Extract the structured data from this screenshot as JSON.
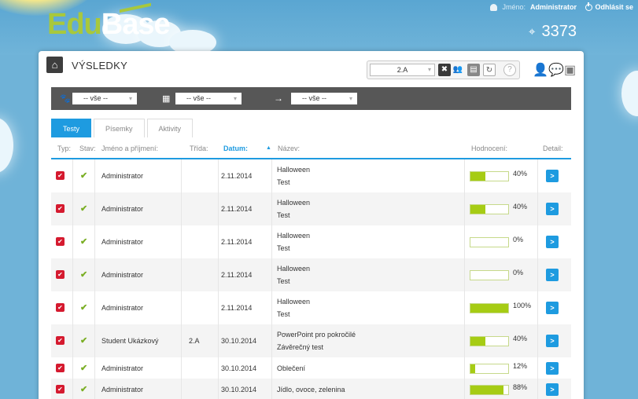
{
  "app": {
    "logo_edu": "Edu",
    "logo_base": "Base"
  },
  "topbar": {
    "user_label": "Jméno:",
    "user_name": "Administrator",
    "logout_label": "Odhlásit se",
    "points": "3373"
  },
  "page": {
    "title": "VÝSLEDKY"
  },
  "toolbar": {
    "class_value": "2.A",
    "help_label": "?"
  },
  "filters": {
    "first": "-- vše --",
    "second": "-- vše --",
    "third": "-- vše --"
  },
  "tabs": [
    {
      "label": "Testy",
      "active": true
    },
    {
      "label": "Písemky",
      "active": false
    },
    {
      "label": "Aktivity",
      "active": false
    }
  ],
  "columns": {
    "type": "Typ:",
    "state": "Stav:",
    "name": "Jméno a příjmení:",
    "class": "Třída:",
    "date": "Datum:",
    "title": "Název:",
    "score": "Hodnocení:",
    "detail": "Detail:"
  },
  "rows": [
    {
      "name": "Administrator",
      "class": "",
      "date": "2.11.2014",
      "title1": "Halloween",
      "title2": "Test",
      "score": "40%",
      "fill": 0.4
    },
    {
      "name": "Administrator",
      "class": "",
      "date": "2.11.2014",
      "title1": "Halloween",
      "title2": "Test",
      "score": "40%",
      "fill": 0.4
    },
    {
      "name": "Administrator",
      "class": "",
      "date": "2.11.2014",
      "title1": "Halloween",
      "title2": "Test",
      "score": "0%",
      "fill": 0.0
    },
    {
      "name": "Administrator",
      "class": "",
      "date": "2.11.2014",
      "title1": "Halloween",
      "title2": "Test",
      "score": "0%",
      "fill": 0.0
    },
    {
      "name": "Administrator",
      "class": "",
      "date": "2.11.2014",
      "title1": "Halloween",
      "title2": "Test",
      "score": "100%",
      "fill": 1.0
    },
    {
      "name": "Student Ukázkový",
      "class": "2.A",
      "date": "30.10.2014",
      "title1": "PowerPoint pro pokročilé",
      "title2": "Závěrečný test",
      "score": "40%",
      "fill": 0.4
    },
    {
      "name": "Administrator",
      "class": "",
      "date": "30.10.2014",
      "title1": "Oblečení",
      "title2": "",
      "score": "12%",
      "fill": 0.12
    },
    {
      "name": "Administrator",
      "class": "",
      "date": "30.10.2014",
      "title1": "Jídlo, ovoce, zelenina",
      "title2": "",
      "score": "88%",
      "fill": 0.88
    }
  ],
  "colors": {
    "accent": "#1e9be0",
    "progress": "#a6cc14",
    "checkbox": "#d51a2f",
    "ok": "#7aae24"
  },
  "icons": [
    "home-icon",
    "user-icon",
    "power-icon",
    "target-icon",
    "paw-icon",
    "calendar-icon",
    "arrow-right-icon",
    "check-icon",
    "chevron-right-icon"
  ]
}
